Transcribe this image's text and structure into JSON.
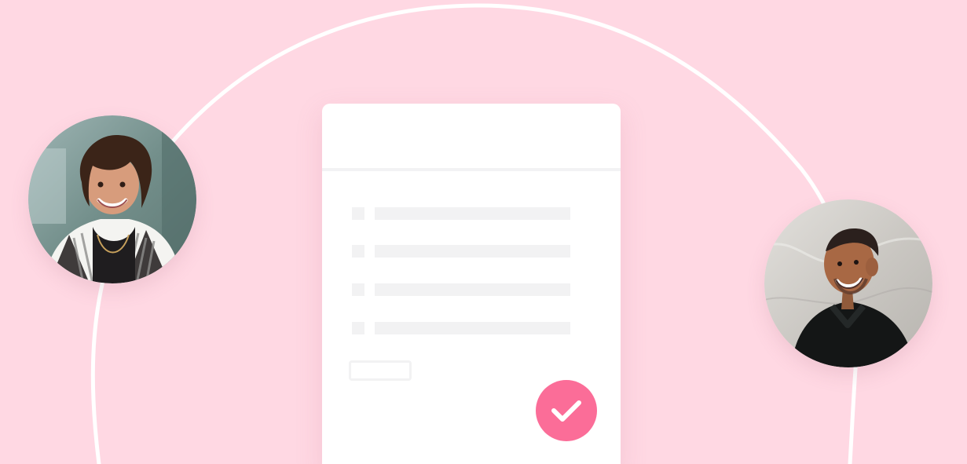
{
  "theme": {
    "background": "#ffd8e3",
    "arc": "#ffffff",
    "card": "#ffffff",
    "placeholder": "#f2f2f3",
    "accent": "#fb6d98"
  },
  "card": {
    "placeholder_rows": 4
  },
  "avatars": [
    {
      "name": "woman-avatar"
    },
    {
      "name": "man-avatar"
    }
  ],
  "icons": {
    "confirm": "checkmark-icon"
  }
}
